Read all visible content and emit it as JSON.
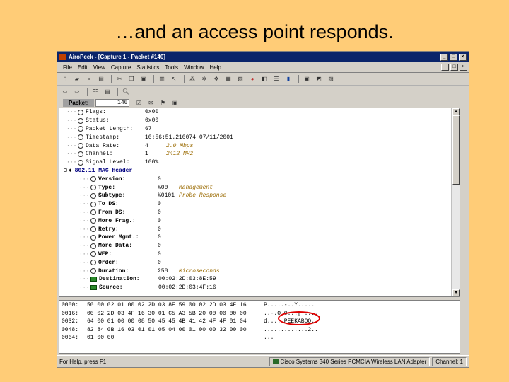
{
  "slide": {
    "title": "…and an access point responds."
  },
  "window": {
    "title": "AiroPeek - [Capture 1 - Packet #140]",
    "menu": [
      "File",
      "Edit",
      "View",
      "Capture",
      "Statistics",
      "Tools",
      "Window",
      "Help"
    ]
  },
  "packetbar": {
    "label": "Packet:",
    "value": "140"
  },
  "decode": {
    "fields": [
      {
        "name": "Flags:",
        "value": "0x00"
      },
      {
        "name": "Status:",
        "value": "0x00"
      },
      {
        "name": "Packet Length:",
        "value": "67"
      },
      {
        "name": "Timestamp:",
        "value": "10:56:51.210074 07/11/2001"
      },
      {
        "name": "Data Rate:",
        "value": "4",
        "desc": "2.0 Mbps"
      },
      {
        "name": "Channel:",
        "value": "1",
        "desc": "2412 MHz"
      },
      {
        "name": "Signal Level:",
        "value": "100%"
      }
    ],
    "header": "802.11 MAC Header",
    "mac_fields": [
      {
        "name": "Version:",
        "value": "0"
      },
      {
        "name": "Type:",
        "value": "%00",
        "desc": "Management"
      },
      {
        "name": "Subtype:",
        "value": "%0101",
        "desc": "Probe Response"
      },
      {
        "name": "To DS:",
        "value": "0"
      },
      {
        "name": "From DS:",
        "value": "0"
      },
      {
        "name": "More Frag.:",
        "value": "0"
      },
      {
        "name": "Retry:",
        "value": "0"
      },
      {
        "name": "Power Mgmt.:",
        "value": "0"
      },
      {
        "name": "More Data:",
        "value": "0"
      },
      {
        "name": "WEP:",
        "value": "0"
      },
      {
        "name": "Order:",
        "value": "0"
      },
      {
        "name": "Duration:",
        "value": "258",
        "desc": "Microseconds"
      }
    ],
    "addr_fields": [
      {
        "name": "Destination:",
        "value": "00:02:2D:03:8E:59"
      },
      {
        "name": "Source:",
        "value": "00:02:2D:03:4F:16"
      }
    ]
  },
  "hex": {
    "rows": [
      {
        "off": "0000:",
        "bytes": "50 00 02 01 00 02 2D 03 8E 59 00 02 2D 03 4F 16",
        "ascii": "P.....-..Y....."
      },
      {
        "off": "0016:",
        "bytes": "00 02 2D 03 4F 16 30 01 C5 A3 5B 20 00 00 00 00",
        "ascii": "..-.O.0...[ ...."
      },
      {
        "off": "0032:",
        "bytes": "64 00 01 00 00 08 50 45 45 4B 41 42 4F 4F 01 04",
        "ascii": "d.....PEEKABOO.."
      },
      {
        "off": "0048:",
        "bytes": "82 84 0B 16 03 01 01 05 04 00 01 00 00 32 00 00",
        "ascii": ".............2.."
      },
      {
        "off": "0064:",
        "bytes": "01 00 00",
        "ascii": "..."
      }
    ]
  },
  "statusbar": {
    "left": "For Help, press F1",
    "adapter": "Cisco Systems 340 Series PCMCIA Wireless LAN Adapter",
    "channel": "Channel: 1"
  }
}
